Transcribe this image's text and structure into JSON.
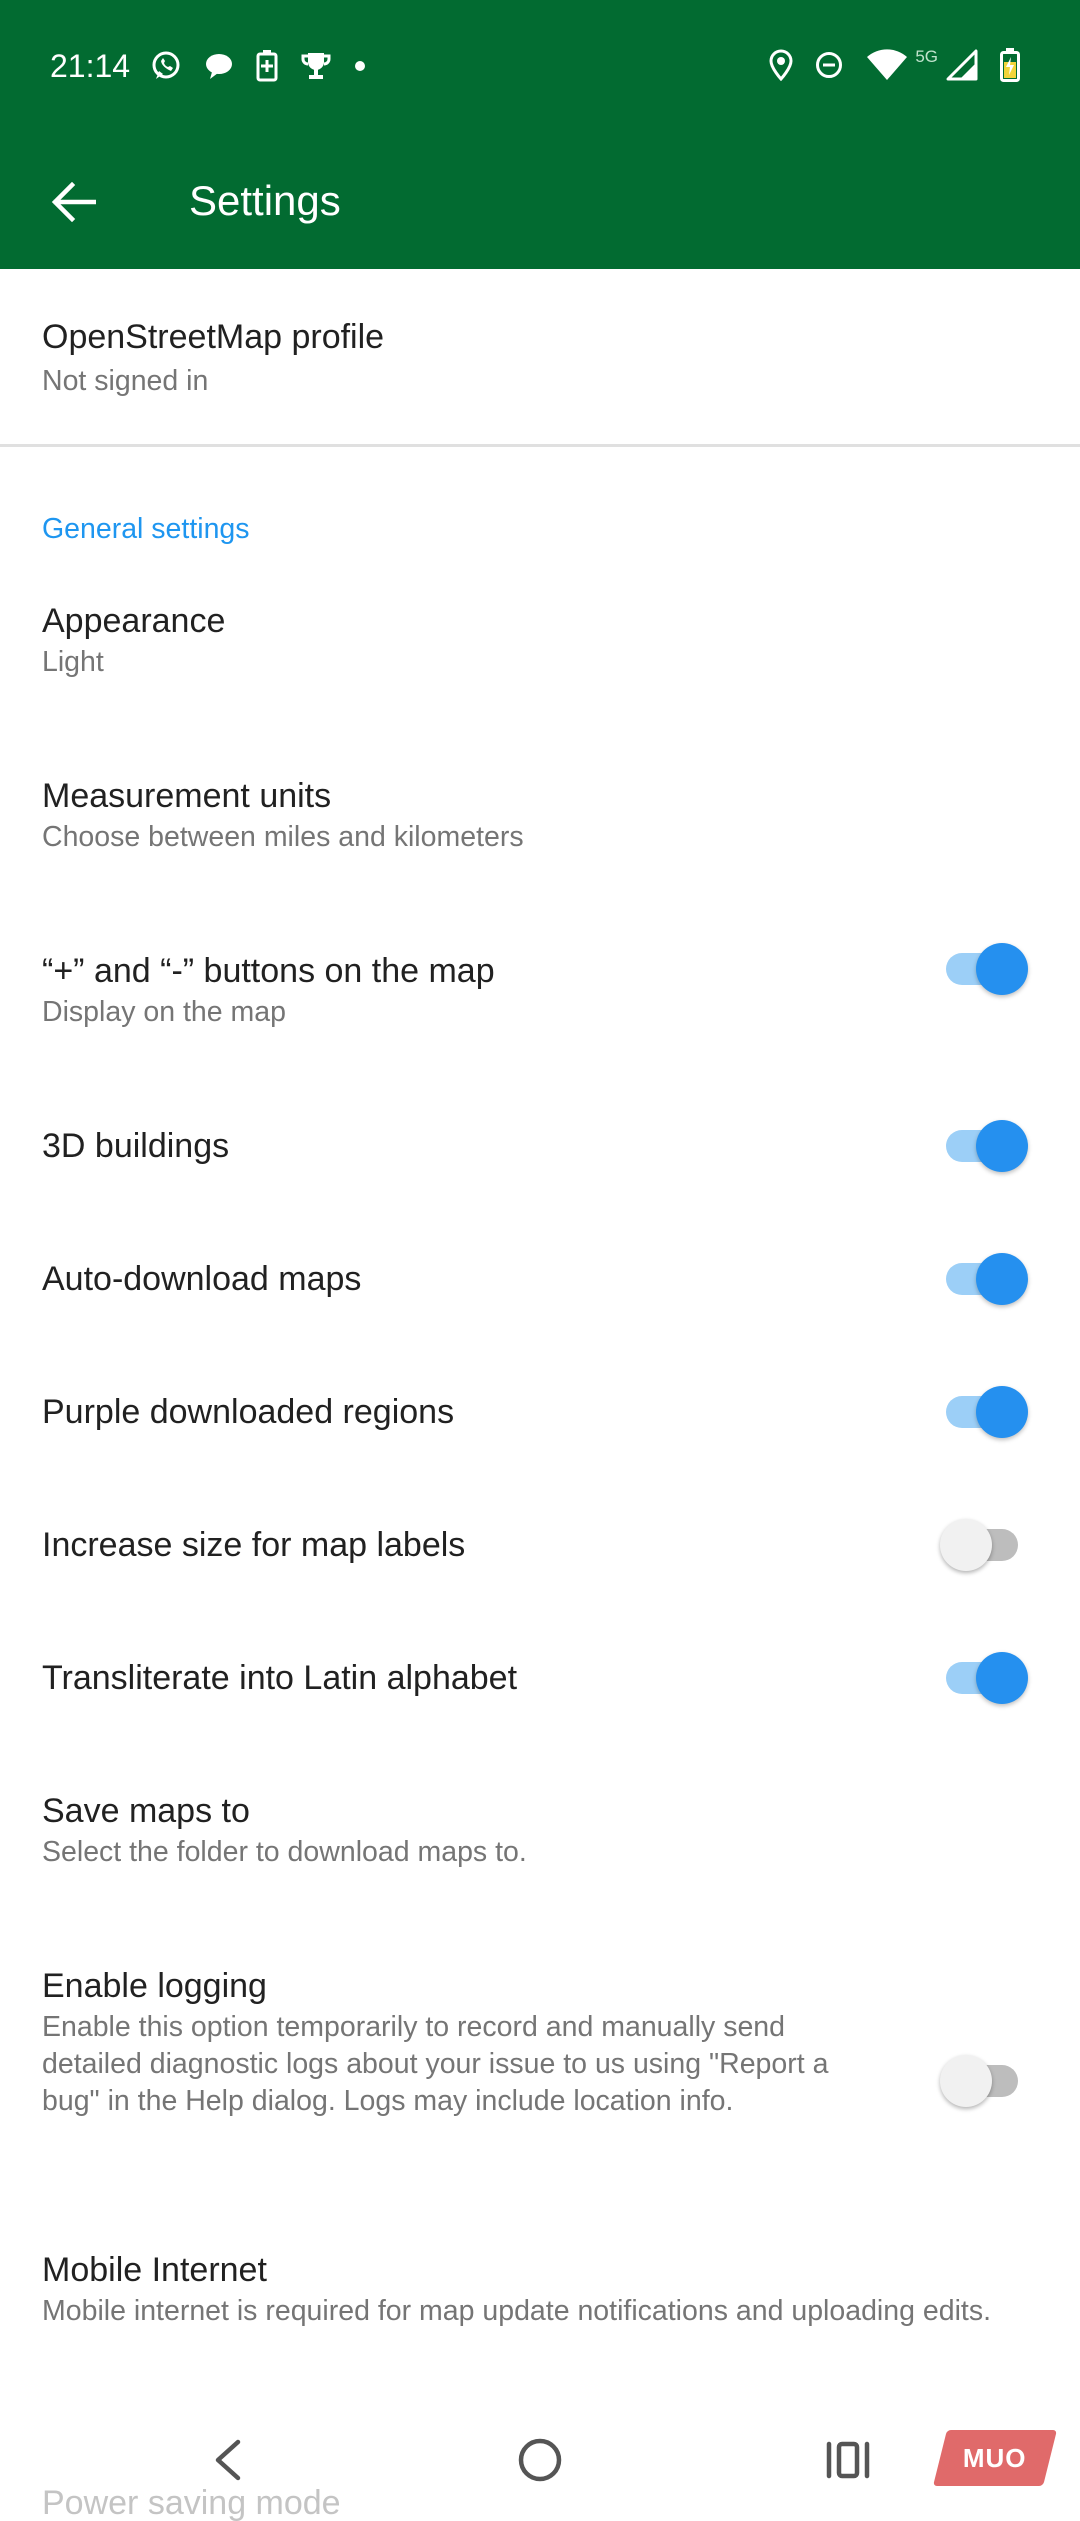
{
  "status_bar": {
    "time": "21:14",
    "left_icons": [
      "whatsapp-icon",
      "chat-bubble-icon",
      "battery-saver-icon",
      "trophy-icon",
      "dot-icon"
    ],
    "right_icons": [
      "location-icon",
      "do-not-disturb-icon",
      "wifi-icon",
      "signal-icon",
      "battery-icon"
    ],
    "network_label": "5G"
  },
  "toolbar": {
    "title": "Settings",
    "back_icon": "arrow-back-icon"
  },
  "profile": {
    "title": "OpenStreetMap profile",
    "subtitle": "Not signed in"
  },
  "general_settings": {
    "header": "General settings",
    "items": [
      {
        "title": "Appearance",
        "subtitle": "Light"
      },
      {
        "title": "Measurement units",
        "subtitle": "Choose between miles and kilometers"
      },
      {
        "title": "“+” and “-” buttons on the map",
        "subtitle": "Display on the map",
        "toggle": true
      },
      {
        "title": "3D buildings",
        "toggle": true
      },
      {
        "title": "Auto-download maps",
        "toggle": true
      },
      {
        "title": "Purple downloaded regions",
        "toggle": true
      },
      {
        "title": "Increase size for map labels",
        "toggle": false
      },
      {
        "title": "Transliterate into Latin alphabet",
        "toggle": true
      },
      {
        "title": "Save maps to",
        "subtitle": "Select the folder to download maps to."
      },
      {
        "title": "Enable logging",
        "subtitle": "Enable this option temporarily to record and manually send detailed diagnostic logs about your issue to us using \"Report a bug\" in the Help dialog. Logs may include location info.",
        "toggle": false
      },
      {
        "title": "Mobile Internet",
        "subtitle": "Mobile internet is required for map update notifications and uploading edits."
      },
      {
        "title": "Power saving mode"
      }
    ]
  },
  "nav_bar": {
    "back_icon": "nav-back-icon",
    "home_icon": "nav-home-icon",
    "recents_icon": "nav-recents-icon"
  },
  "watermark": {
    "text": "MUO"
  },
  "colors": {
    "app_bar": "#026b31",
    "accent": "#1e96f0",
    "switch_on_thumb": "#2590ef",
    "switch_on_track": "#9ccff7",
    "switch_off_thumb": "#f1f1f1",
    "switch_off_track": "#bdbdbd"
  }
}
